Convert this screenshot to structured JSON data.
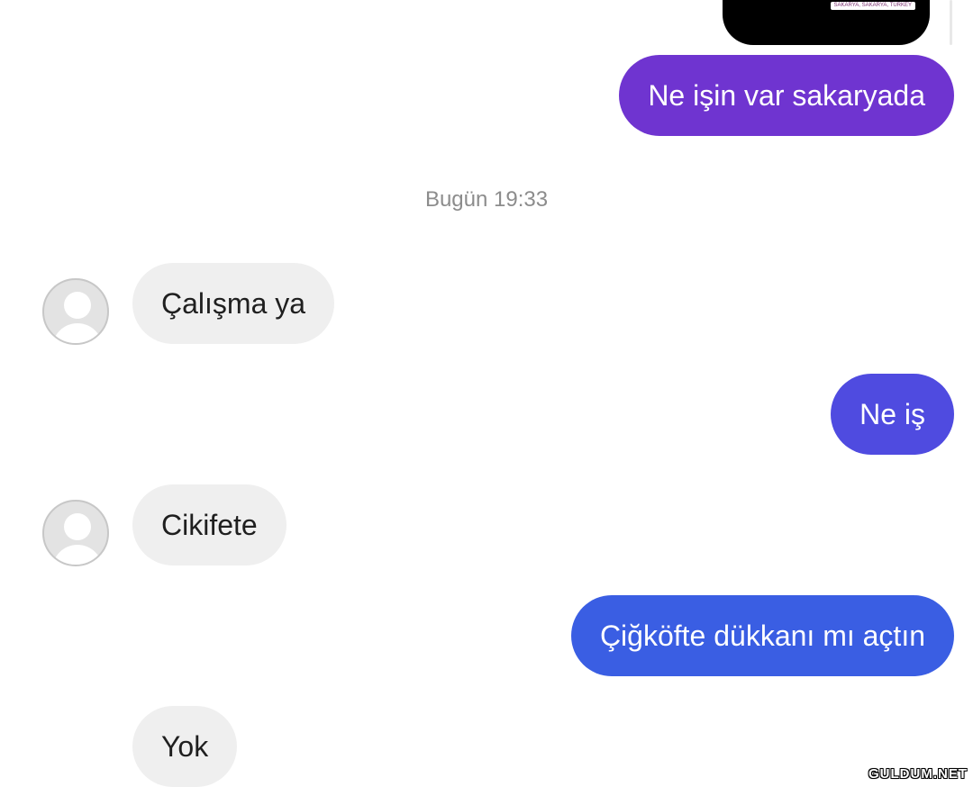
{
  "media": {
    "caption": "SAKARYA, SAKARYA, TURKEY"
  },
  "timestamp": "Bugün 19:33",
  "messages": [
    {
      "direction": "sent",
      "text": "Ne işin var sakaryada",
      "color": "#6f34d0"
    },
    {
      "direction": "received",
      "text": "Çalışma ya"
    },
    {
      "direction": "sent",
      "text": "Ne iş",
      "color": "#4f4be0"
    },
    {
      "direction": "received",
      "text": "Cikifete"
    },
    {
      "direction": "sent",
      "text": "Çiğköfte dükkanı mı açtın",
      "color": "#3a5ee3"
    },
    {
      "direction": "received",
      "text": "Yok"
    }
  ],
  "colors": {
    "received_bubble": "#efefef",
    "sent_gradient_top": "#7a31cf",
    "sent_gradient_bottom": "#3460e4"
  },
  "watermark": "GULDUM.NET"
}
